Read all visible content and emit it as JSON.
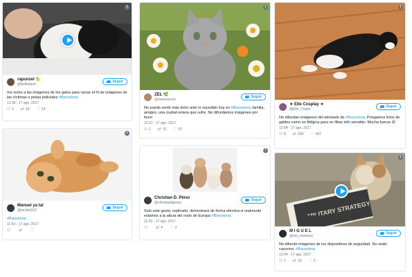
{
  "follow_label": "Seguir",
  "info_glyph": "i",
  "colors": {
    "accent": "#1da1f2",
    "link": "#1b95e0",
    "muted": "#657786",
    "border": "#e1e8ed"
  },
  "tweets": [
    {
      "name": "rapunzel 🐈",
      "handle": "@bolholand",
      "text_before": "me sumo a las imágenes de los gatos para vaciar el ht de imágenes de las víctimas o pistas policiales ",
      "hashtag": "#Barcelona",
      "text_after": "",
      "date": "12:36 - 17 ago. 2017",
      "replies": "1",
      "retweets": "18",
      "likes": "24",
      "media": "video of a black and white cat"
    },
    {
      "name": "Manuel ya tal",
      "handle": "@mcinni153",
      "text_before": "",
      "hashtag": "#Barcelona",
      "text_after": "",
      "date": "11:53 - 17 ago. 2017",
      "replies": "",
      "retweets": "",
      "likes": "",
      "media": "orange kitten lying on back"
    },
    {
      "name": "ZEL 🌿",
      "handle": "@merezeccm",
      "text_before": "No puedo sentir más dolor ante lo sucedido hoy en ",
      "hashtag": "#Barcelona",
      "text_after": ", familia, amigos, una ciudad entera que sufre. No difundamos imágenes por favor",
      "date": "12:37 - 17 ago. 2017",
      "replies": "1",
      "retweets": "31",
      "likes": "97",
      "media": "grey kitten among daisies"
    },
    {
      "name": "Christian D. Pérez",
      "handle": "@christiandperez",
      "text_before": "Solo este gesto, replicado, demostrará de forma efectiva si realmente estamos a la altura del resto de Europa ",
      "hashtag": "#Barcelona",
      "text_after": "",
      "date": "11:53 - 17 ago. 2017",
      "replies": "",
      "retweets": "4",
      "likes": "3",
      "media": "four kittens"
    },
    {
      "name": "★ Elle Cosplay ★",
      "handle": "@Elle_Copier",
      "text_before": "No difundan imágenes del atentado de ",
      "hashtag": "#Barcelona",
      "text_after": ". Pongamos fotos de gatitos como en Bélgica para no filtrar info sensible. Mucha fuerza 😢",
      "date": "12:04 - 17 ago. 2017",
      "replies": "5",
      "retweets": "609",
      "likes": "497",
      "media": "black and white cat on wooden floor"
    },
    {
      "name": "M I G U E L",
      "handle": "@mo_martinez",
      "text_before": "No difundir imágenes de los dispositivos de seguridad. No seáis cazurros. ",
      "hashtag": "#Barcelona",
      "text_after": "",
      "date": "12:04 - 17 ago. 2017",
      "replies": "1",
      "retweets": "16",
      "likes": "5",
      "media": "video of a cat reading a book",
      "book_title": "MILITARY STRATEGY"
    }
  ]
}
